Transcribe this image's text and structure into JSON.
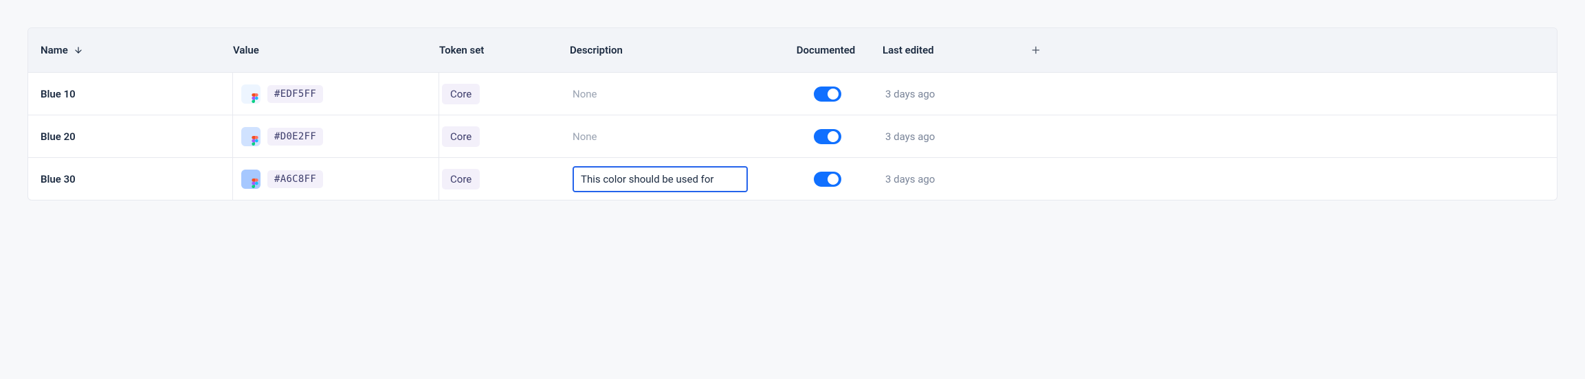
{
  "columns": {
    "name": "Name",
    "value": "Value",
    "tokenSet": "Token set",
    "description": "Description",
    "documented": "Documented",
    "lastEdited": "Last edited"
  },
  "rows": [
    {
      "name": "Blue 10",
      "hex": "#EDF5FF",
      "swatch": "#EDF5FF",
      "tokenSet": "Core",
      "description": "None",
      "descriptionEditing": false,
      "documented": true,
      "lastEdited": "3 days ago"
    },
    {
      "name": "Blue 20",
      "hex": "#D0E2FF",
      "swatch": "#D0E2FF",
      "tokenSet": "Core",
      "description": "None",
      "descriptionEditing": false,
      "documented": true,
      "lastEdited": "3 days ago"
    },
    {
      "name": "Blue 30",
      "hex": "#A6C8FF",
      "swatch": "#A6C8FF",
      "tokenSet": "Core",
      "description": "This color should be used for",
      "descriptionEditing": true,
      "documented": true,
      "lastEdited": "3 days ago"
    }
  ]
}
